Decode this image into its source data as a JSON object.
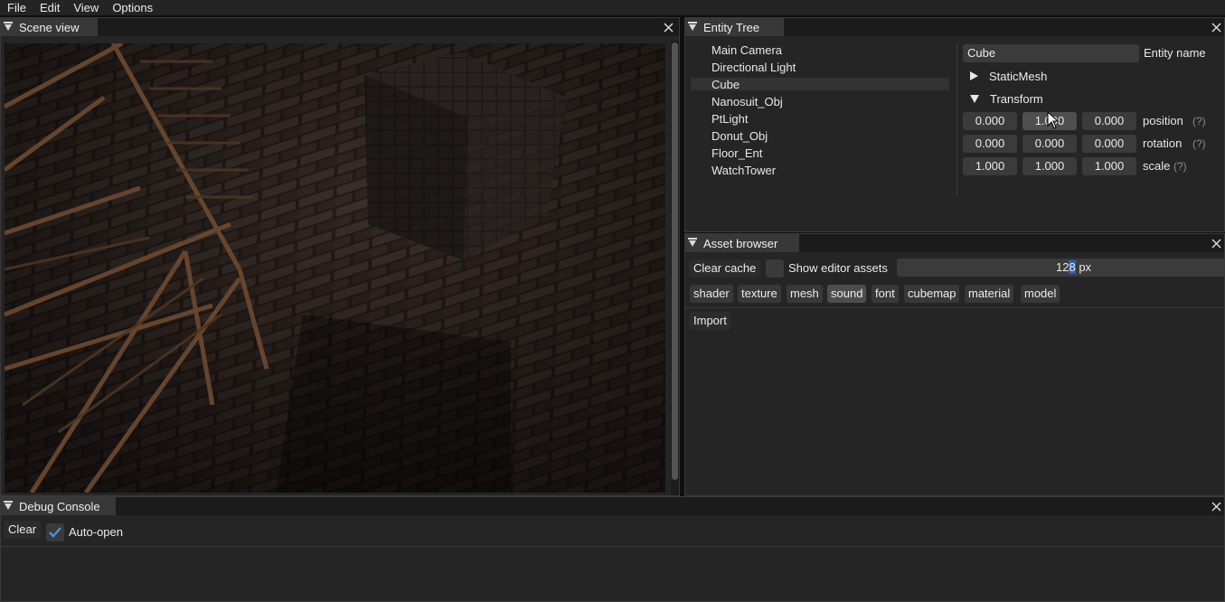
{
  "menu": [
    "File",
    "Edit",
    "View",
    "Options"
  ],
  "scene_view": {
    "title": "Scene view"
  },
  "entity_tree": {
    "title": "Entity Tree",
    "items": [
      "Main Camera",
      "Directional Light",
      "Cube",
      "Nanosuit_Obj",
      "PtLight",
      "Donut_Obj",
      "Floor_Ent",
      "WatchTower"
    ],
    "selected": "Cube"
  },
  "inspector": {
    "entity_name_value": "Cube",
    "entity_name_label": "Entity name",
    "sections": [
      {
        "label": "StaticMesh",
        "expanded": false
      },
      {
        "label": "Transform",
        "expanded": true
      }
    ],
    "transform": {
      "position": {
        "label": "position",
        "values": [
          "0.000",
          "1.090",
          "0.000"
        ],
        "help": "(?)"
      },
      "rotation": {
        "label": "rotation",
        "values": [
          "0.000",
          "0.000",
          "0.000"
        ],
        "help": "(?)"
      },
      "scale": {
        "label": "scale",
        "values": [
          "1.000",
          "1.000",
          "1.000"
        ],
        "help": "(?)"
      }
    }
  },
  "asset_browser": {
    "title": "Asset browser",
    "clear_cache": "Clear cache",
    "show_editor_assets": "Show editor assets",
    "size_value_a": "12",
    "size_value_b": "8",
    "size_unit": " px",
    "tags": [
      "shader",
      "texture",
      "mesh",
      "sound",
      "font",
      "cubemap",
      "material",
      "model"
    ],
    "selected_tag": "sound",
    "import": "Import"
  },
  "debug_console": {
    "title": "Debug Console",
    "clear": "Clear",
    "auto_open": "Auto-open",
    "auto_open_checked": true
  },
  "colors": {
    "accent": "#2b63b0",
    "checkmark": "#4a90e2"
  },
  "icons": [
    "collapse-triangle-icon",
    "close-icon",
    "tree-arrow-right-icon",
    "tree-arrow-down-icon",
    "checkmark-icon",
    "mouse-cursor-icon"
  ]
}
